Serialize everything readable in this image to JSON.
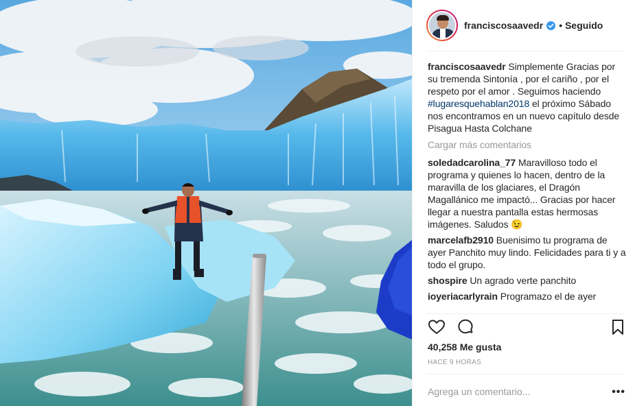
{
  "header": {
    "username": "franciscosaavedr",
    "separator": "•",
    "follow_status": "Seguido"
  },
  "caption": {
    "username": "franciscosaavedr",
    "text_before": "Simplemente Gracias por su tremenda Sintonía , por el cariño , por el respeto por el amor . Seguimos haciendo",
    "hashtag": "#lugaresquehablan2018",
    "text_after": "el próximo Sábado nos encontramos en un nuevo capítulo desde Pisagua Hasta Colchane"
  },
  "load_more": "Cargar más comentarios",
  "comments": [
    {
      "user": "soledadcarolina_77",
      "text": "Maravilloso todo el programa y quienes lo hacen, dentro de la maravilla de los glaciares, el Dragón Magallánico me impactó... Gracias por hacer llegar a nuestra pantalla estas hermosas imágenes. Saludos 😉"
    },
    {
      "user": "marcelafb2910",
      "text": "Buenisimo tu programa de ayer Panchito muy lindo. Felicidades para ti y a todo el grupo."
    },
    {
      "user": "shospire",
      "text": "Un agrado verte panchito"
    },
    {
      "user": "ioyeriacarlyrain",
      "text": "Programazo el de ayer"
    }
  ],
  "likes": "40,258 Me gusta",
  "timestamp": "HACE 9 HORAS",
  "add_comment_placeholder": "Agrega un comentario...",
  "more_label": "•••",
  "icons": {
    "like": "heart-icon",
    "comment": "comment-bubble-icon",
    "save": "bookmark-icon",
    "verified": "verified-badge-icon"
  },
  "colors": {
    "link": "#003569",
    "verified": "#3897f0",
    "muted": "#999999"
  }
}
